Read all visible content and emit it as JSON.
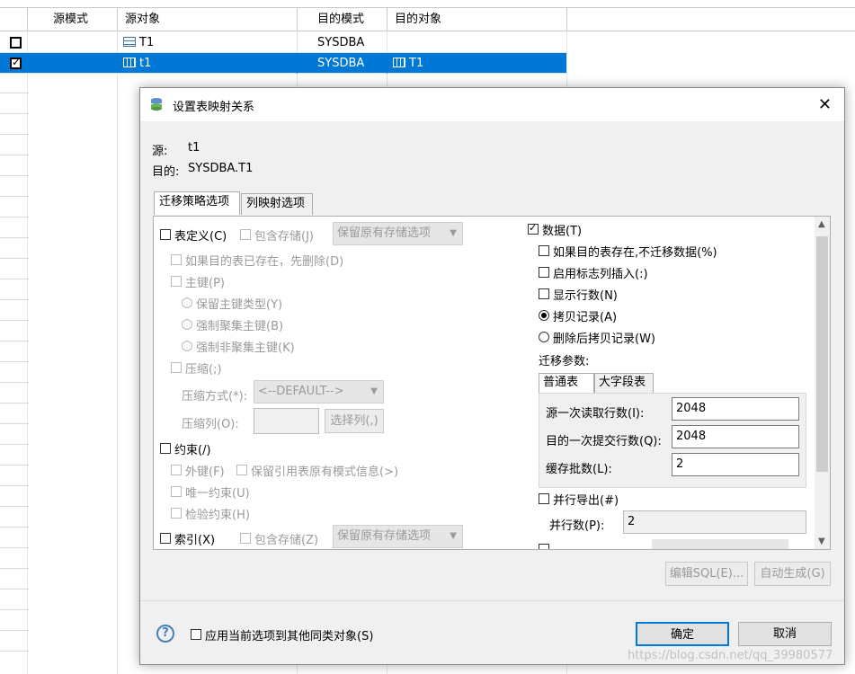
{
  "grid": {
    "headers": [
      "",
      "源模式",
      "源对象",
      "目的模式",
      "目的对象"
    ],
    "rows": [
      {
        "checked": false,
        "src_schema": "",
        "src_object": "T1",
        "dst_schema": "SYSDBA",
        "dst_object": ""
      },
      {
        "checked": true,
        "src_schema": "",
        "src_object": "t1",
        "dst_schema": "SYSDBA",
        "dst_object": "T1"
      }
    ]
  },
  "dialog": {
    "title": "设置表映射关系",
    "close": "✕",
    "source_label": "源:",
    "source_value": "t1",
    "target_label": "目的:",
    "target_value": "SYSDBA.T1",
    "tabs": [
      "迁移策略选项",
      "列映射选项"
    ],
    "left": {
      "table_def": "表定义(C)",
      "include_storage": "包含存储(J)",
      "storage_combo": "保留原有存储选项",
      "drop_if_exists": "如果目的表已存在，先删除(D)",
      "primary_key": "主键(P)",
      "keep_pk_type": "保留主键类型(Y)",
      "force_cluster_pk": "强制聚集主键(B)",
      "force_noncluster_pk": "强制非聚集主键(K)",
      "compress": "压缩(;)",
      "compress_mode_label": "压缩方式(*):",
      "compress_mode_value": "<--DEFAULT-->",
      "compress_cols_label": "压缩列(O):",
      "select_cols_btn": "选择列(,)",
      "constraint": "约束(/)",
      "foreign_key": "外键(F)",
      "keep_ref_schema": "保留引用表原有模式信息(>)",
      "unique": "唯一约束(U)",
      "check": "检验约束(H)",
      "index": "索引(X)",
      "index_include_storage": "包含存储(Z)",
      "index_storage_combo": "保留原有存储选项"
    },
    "right": {
      "data": "数据(T)",
      "skip_if_exists": "如果目的表存在,不迁移数据(%)",
      "identity_insert": "启用标志列插入(:)",
      "show_rows": "显示行数(N)",
      "copy_records": "拷贝记录(A)",
      "delete_then_copy": "删除后拷贝记录(W)",
      "params_label": "迁移参数:",
      "subtabs": [
        "普通表",
        "大字段表"
      ],
      "read_rows_label": "源一次读取行数(I):",
      "read_rows_value": "2048",
      "commit_rows_label": "目的一次提交行数(Q):",
      "commit_rows_value": "2048",
      "batch_label": "缓存批数(L):",
      "batch_value": "2",
      "parallel_export": "并行导出(#)",
      "parallel_count_label": "并行数(P):",
      "parallel_count_value": "2"
    },
    "edit_sql_btn": "编辑SQL(E)...",
    "auto_gen_btn": "自动生成(G)",
    "apply_all": "应用当前选项到其他同类对象(S)",
    "ok": "确定",
    "cancel": "取消"
  },
  "watermark": "https://blog.csdn.net/qq_39980577",
  "colors": {
    "selection": "#0078d7",
    "dialog_bg": "#f0f0f0"
  }
}
